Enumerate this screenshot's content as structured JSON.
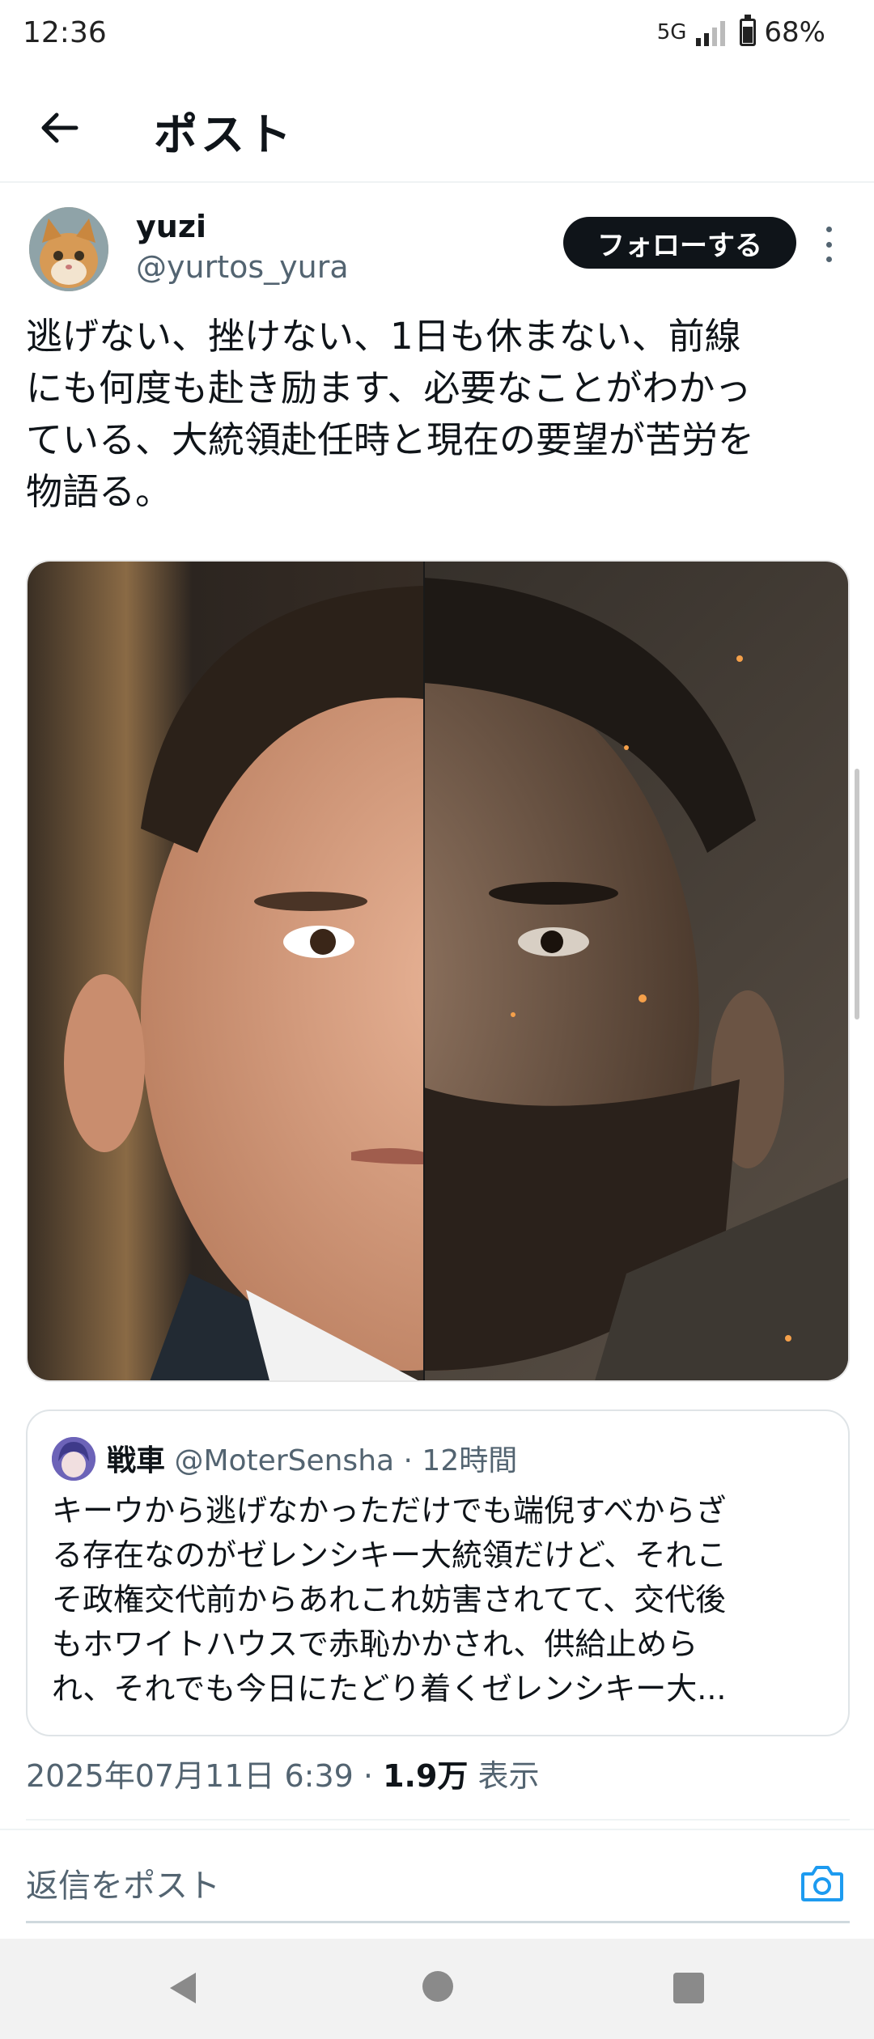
{
  "status_bar": {
    "time": "12:36",
    "network": "5G",
    "battery": "68%"
  },
  "header": {
    "title": "ポスト"
  },
  "author": {
    "display_name": "yuzi",
    "handle": "@yurtos_yura",
    "follow_label": "フォローする"
  },
  "post": {
    "lines": [
      "逃げない、挫けない、1日も休まない、前線",
      "にも何度も赴き励ます、必要なことがわかっ",
      "ている、大統領赴任時と現在の要望が苦労を",
      "物語る。"
    ]
  },
  "quote": {
    "name": "戦車",
    "handle": "@MoterSensha",
    "separator": " · ",
    "time": "12時間",
    "lines": [
      "キーウから逃げなかっただけでも端倪すべからざ",
      "る存在なのがゼレンシキー大統領だけど、それこ",
      "そ政権交代前からあれこれ妨害されてて、交代後",
      "もホワイトハウスで赤恥かかされ、供給止めら",
      "れ、それでも今日にたどり着くゼレンシキー大..."
    ]
  },
  "meta": {
    "timestamp": "2025年07月11日 6:39",
    "separator": " · ",
    "views_count": "1.9万",
    "views_label": " 表示"
  },
  "reply": {
    "placeholder": "返信をポスト"
  },
  "colors": {
    "accent": "#1d9bf0",
    "text": "#0f1419",
    "secondary": "#536471"
  }
}
